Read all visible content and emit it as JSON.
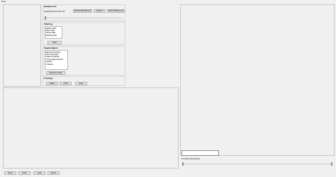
{
  "window": {
    "title": "Proc"
  },
  "background": {
    "title": "Background",
    "neighborhood_label": "Neighborhood size",
    "neighborhood_value": "15",
    "buttons": [
      "Median Background",
      "Variance",
      "Mean Background"
    ]
  },
  "filtering": {
    "title": "Filtering",
    "items": [
      "Median Filter",
      "Mean Filter",
      "Gauss Filter",
      "Bilateral Filter"
    ],
    "button": "Filter"
  },
  "segmentation": {
    "title": "Segmentation",
    "items": [
      "Manual Threshold",
      "Otsu Threshold",
      "Adapt Threshold",
      "Canny Edge Detector",
      "Laplace",
      "K-Means"
    ],
    "button": "Segment Image"
  },
  "tracking": {
    "title": "Tracking",
    "buttons": [
      "Labels",
      "Track",
      "Save"
    ]
  },
  "contrast": {
    "title": "Contrast Stretching"
  },
  "bottom_buttons": [
    "Reset",
    "Undo",
    "Load",
    "Export"
  ]
}
